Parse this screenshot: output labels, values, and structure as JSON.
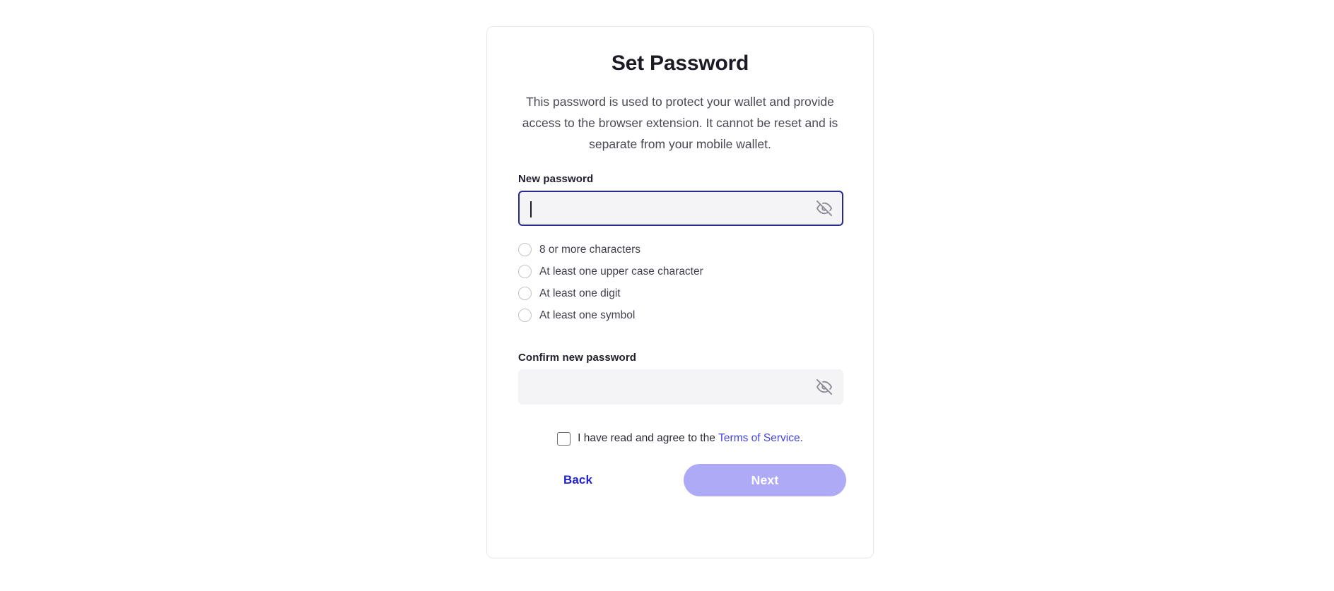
{
  "card": {
    "title": "Set Password",
    "description": "This password is used to protect your wallet and provide access to the browser extension. It cannot be reset and is separate from your mobile wallet."
  },
  "new_password": {
    "label": "New password",
    "value": "",
    "placeholder": "",
    "visibility_icon": "eye-off-icon",
    "focused": true
  },
  "requirements": [
    {
      "label": "8 or more characters",
      "met": false
    },
    {
      "label": "At least one upper case character",
      "met": false
    },
    {
      "label": "At least one digit",
      "met": false
    },
    {
      "label": "At least one symbol",
      "met": false
    }
  ],
  "confirm_password": {
    "label": "Confirm new password",
    "value": "",
    "placeholder": "",
    "visibility_icon": "eye-off-icon",
    "focused": false
  },
  "terms": {
    "checked": false,
    "text_before": "I have read and agree to the",
    "link_label": "Terms of Service",
    "period": "."
  },
  "actions": {
    "back_label": "Back",
    "next_label": "Next",
    "next_disabled": true
  },
  "colors": {
    "page_background": "#ffffff",
    "card_border": "#e9e9ec",
    "input_background": "#f4f4f6",
    "input_focus_border": "#2a2a8e",
    "heading": "#1b1b26",
    "body_text": "#4a4a55",
    "link": "#4444e0",
    "back_text": "#2323cf",
    "next_background": "#aeaaf6",
    "next_text": "#ffffff",
    "requirement_circle": "#c3c3ca",
    "eye_icon": "#8a8a96"
  }
}
